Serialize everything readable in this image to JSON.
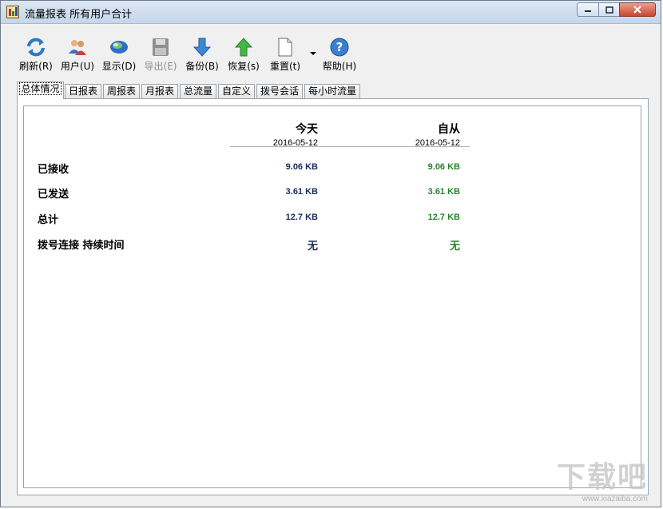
{
  "window": {
    "title": "流量报表 所有用户合计",
    "colors": {
      "titlebar": "#c6d6ea",
      "close_button": "#c9452d"
    }
  },
  "toolbar": {
    "items": [
      {
        "label": "刷新(R)",
        "icon": "refresh-icon",
        "enabled": true
      },
      {
        "label": "用户(U)",
        "icon": "users-icon",
        "enabled": true
      },
      {
        "label": "显示(D)",
        "icon": "display-icon",
        "enabled": true
      },
      {
        "label": "导出(E)",
        "icon": "floppy-disk-icon",
        "enabled": false
      },
      {
        "label": "备份(B)",
        "icon": "down-arrow-icon",
        "enabled": true
      },
      {
        "label": "恢复(s)",
        "icon": "up-arrow-icon",
        "enabled": true
      },
      {
        "label": "重置(t)",
        "icon": "blank-document-icon",
        "enabled": true
      },
      {
        "label": "帮助(H)",
        "icon": "help-icon",
        "enabled": true
      }
    ]
  },
  "tabs": [
    {
      "label": "总体情况",
      "active": true
    },
    {
      "label": "日报表",
      "active": false
    },
    {
      "label": "周报表",
      "active": false
    },
    {
      "label": "月报表",
      "active": false
    },
    {
      "label": "总流量",
      "active": false
    },
    {
      "label": "自定义",
      "active": false
    },
    {
      "label": "拨号会话",
      "active": false
    },
    {
      "label": "每小时流量",
      "active": false
    }
  ],
  "summary": {
    "columns": [
      {
        "title": "今天",
        "date": "2016-05-12"
      },
      {
        "title": "自从",
        "date": "2016-05-12"
      }
    ],
    "rows": [
      {
        "label": "已接收",
        "today": "9.06 KB",
        "since": "9.06 KB"
      },
      {
        "label": "已发送",
        "today": "3.61 KB",
        "since": "3.61 KB"
      },
      {
        "label": "总计",
        "today": "12.7 KB",
        "since": "12.7 KB"
      },
      {
        "label": "拨号连接 持续时间",
        "today": "无",
        "since": "无"
      }
    ],
    "colors": {
      "today": "#1c2a5a",
      "since": "#27822e"
    }
  },
  "watermark": {
    "text": "下载吧",
    "sub": "www.xiazaiba.com"
  }
}
